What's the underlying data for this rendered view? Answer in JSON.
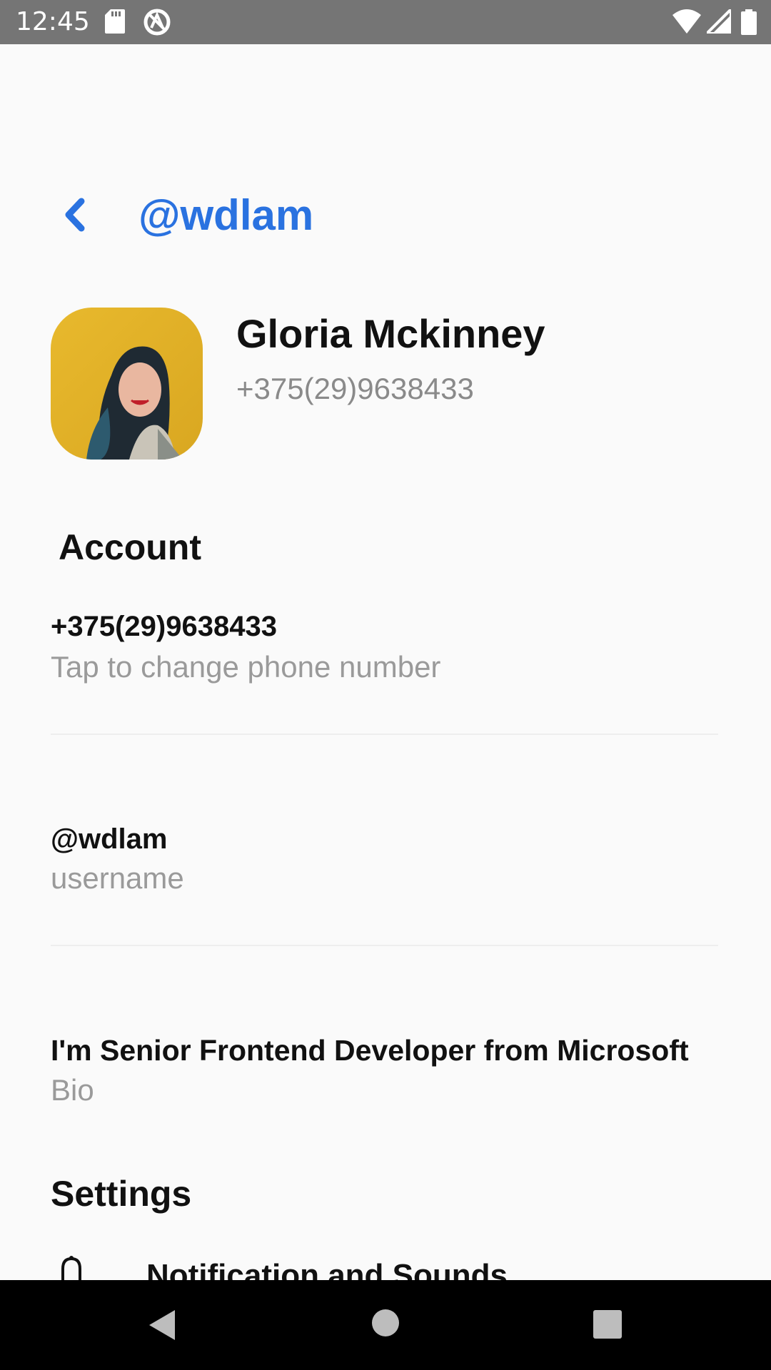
{
  "status_bar": {
    "time": "12:45",
    "icons": [
      "sd-card-icon",
      "a-circle-icon",
      "wifi-icon",
      "signal-icon",
      "battery-icon"
    ]
  },
  "header": {
    "title": "@wdlam",
    "back_icon": "chevron-left-icon"
  },
  "profile": {
    "name": "Gloria Mckinney",
    "phone": "+375(29)9638433"
  },
  "account": {
    "heading": "Account",
    "phone_value": "+375(29)9638433",
    "phone_label": "Tap to change phone number",
    "username_value": "@wdlam",
    "username_label": "username",
    "bio_value": "I'm Senior Frontend Developer from Microsoft",
    "bio_label": "Bio"
  },
  "settings": {
    "heading": "Settings",
    "items": [
      {
        "label": "Notification and Sounds",
        "icon": "bell-icon"
      }
    ]
  },
  "nav_bar": {
    "icons": [
      "back-triangle-icon",
      "home-circle-icon",
      "recents-square-icon"
    ]
  },
  "colors": {
    "accent": "#2a72e0",
    "text_primary": "#111111",
    "text_secondary": "#9a9a9a",
    "background": "#fafafa",
    "status_bar": "#757575"
  }
}
